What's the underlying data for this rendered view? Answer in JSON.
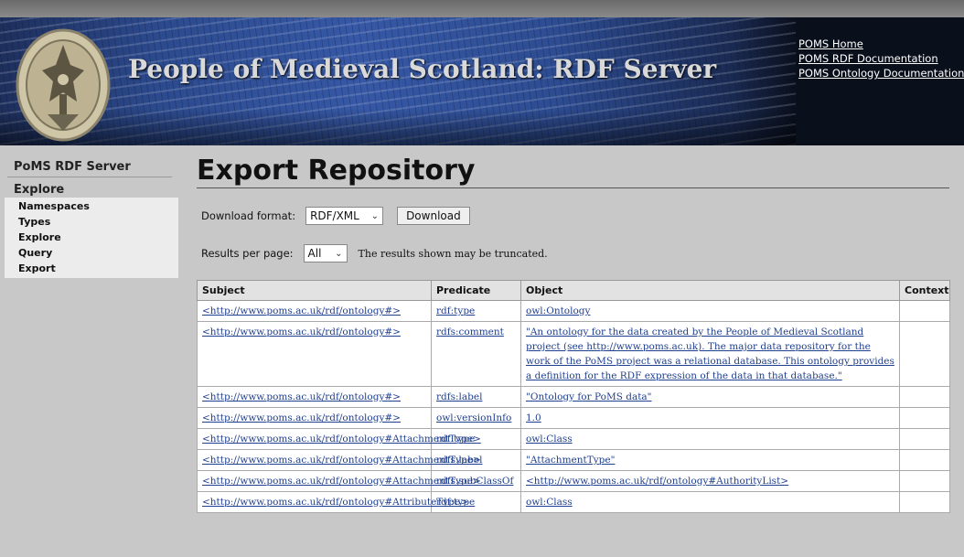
{
  "banner": {
    "title": "People of Medieval Scotland: RDF Server",
    "links": [
      "POMS Home",
      "POMS RDF Documentation",
      "POMS Ontology Documentation"
    ]
  },
  "sidebar": {
    "heading": "PoMS RDF Server",
    "section": "Explore",
    "items": [
      "Namespaces",
      "Types",
      "Explore",
      "Query",
      "Export"
    ]
  },
  "main": {
    "title": "Export Repository",
    "download_format_label": "Download format:",
    "download_format_value": "RDF/XML",
    "download_button": "Download",
    "results_per_page_label": "Results per page:",
    "results_per_page_value": "All",
    "truncated_note": "The results shown may be truncated."
  },
  "table": {
    "headers": [
      "Subject",
      "Predicate",
      "Object",
      "Context"
    ],
    "rows": [
      {
        "subject": "<http://www.poms.ac.uk/rdf/ontology#>",
        "predicate": "rdf:type",
        "object": "owl:Ontology",
        "context": ""
      },
      {
        "subject": "<http://www.poms.ac.uk/rdf/ontology#>",
        "predicate": "rdfs:comment",
        "object": "\"An ontology for the data created by the People of Medieval Scotland project (see http://www.poms.ac.uk). The major data repository for the work of the PoMS project was a relational database. This ontology provides a definition for the RDF expression of the data in that database.\"",
        "context": ""
      },
      {
        "subject": "<http://www.poms.ac.uk/rdf/ontology#>",
        "predicate": "rdfs:label",
        "object": "\"Ontology for PoMS data\"",
        "context": ""
      },
      {
        "subject": "<http://www.poms.ac.uk/rdf/ontology#>",
        "predicate": "owl:versionInfo",
        "object": "1.0",
        "context": ""
      },
      {
        "subject": "<http://www.poms.ac.uk/rdf/ontology#AttachmentType>",
        "predicate": "rdf:type",
        "object": "owl:Class",
        "context": ""
      },
      {
        "subject": "<http://www.poms.ac.uk/rdf/ontology#AttachmentType>",
        "predicate": "rdfs:label",
        "object": "\"AttachmentType\"",
        "context": ""
      },
      {
        "subject": "<http://www.poms.ac.uk/rdf/ontology#AttachmentType>",
        "predicate": "rdfs:subClassOf",
        "object": "<http://www.poms.ac.uk/rdf/ontology#AuthorityList>",
        "context": ""
      },
      {
        "subject": "<http://www.poms.ac.uk/rdf/ontology#AttributeType>",
        "predicate": "rdf:type",
        "object": "owl:Class",
        "context": ""
      }
    ]
  }
}
